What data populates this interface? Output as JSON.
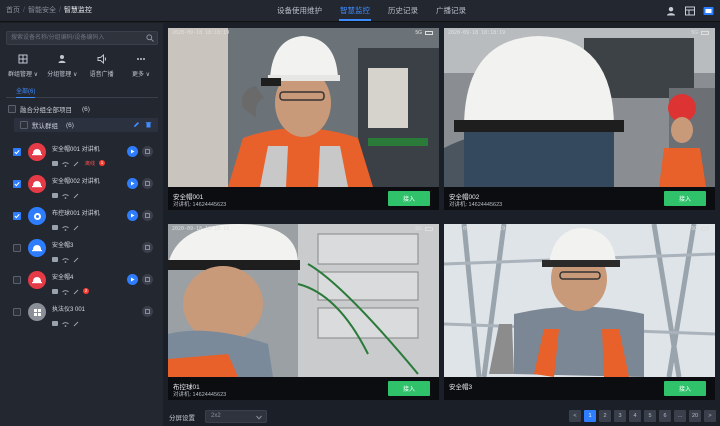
{
  "breadcrumb": [
    "首页",
    "智能安全",
    "智慧监控"
  ],
  "topnav": [
    {
      "label": "设备使用维护",
      "active": false
    },
    {
      "label": "智慧监控",
      "active": true
    },
    {
      "label": "历史记录",
      "active": false
    },
    {
      "label": "广播记录",
      "active": false
    }
  ],
  "sidebar": {
    "search_placeholder": "搜索设备名称/分组编码/设备编码入",
    "tools": [
      {
        "label": "群组管理 ∨",
        "icon": "group-manage-icon"
      },
      {
        "label": "分组管理 ∨",
        "icon": "user-group-icon"
      },
      {
        "label": "语音广播",
        "icon": "broadcast-icon"
      },
      {
        "label": "更多 ∨",
        "icon": "more-icon"
      }
    ],
    "tab": "全部(6)",
    "group": {
      "label": "融合分组全部项目",
      "count": "(6)"
    },
    "subgroup": {
      "label": "默认群组",
      "count": "(6)"
    },
    "devices": [
      {
        "name": "安全帽001 对讲机",
        "checked": true,
        "color": "#e53b47",
        "alert": "离线",
        "badge": "1"
      },
      {
        "name": "安全帽002 对讲机",
        "checked": true,
        "color": "#e53b47",
        "alert": "",
        "badge": ""
      },
      {
        "name": "布控球001 对讲机",
        "checked": true,
        "color": "#2f7dff",
        "alert": "",
        "badge": ""
      },
      {
        "name": "安全帽3",
        "checked": false,
        "color": "#2f7dff",
        "alert": "",
        "badge": ""
      },
      {
        "name": "安全帽4",
        "checked": false,
        "color": "#e53b47",
        "alert": "",
        "badge": "2"
      },
      {
        "name": "执法仪3 001",
        "checked": false,
        "color": "#8a8f98",
        "alert": "",
        "badge": ""
      }
    ]
  },
  "tiles": [
    {
      "name": "安全帽001",
      "phone": "对讲机: 14624445623",
      "timestamp": "2020-09-18 18:18:19",
      "join": "接入"
    },
    {
      "name": "安全帽002",
      "phone": "对讲机: 14624445623",
      "timestamp": "2020-09-18 18:18:19",
      "join": "接入"
    },
    {
      "name": "布控球01",
      "phone": "对讲机: 14624445623",
      "timestamp": "2020-09-18 18:18:19",
      "join": "接入"
    },
    {
      "name": "安全帽3",
      "phone": "",
      "timestamp": "2020-09-18 18:18:19",
      "join": "接入"
    }
  ],
  "signal_text": "5G",
  "bottom": {
    "split_label": "分屏设置",
    "split_value": "2x2",
    "pages": [
      "<",
      "1",
      "2",
      "3",
      "4",
      "5",
      "6",
      "...",
      "20",
      ">"
    ],
    "active_page": "1"
  }
}
